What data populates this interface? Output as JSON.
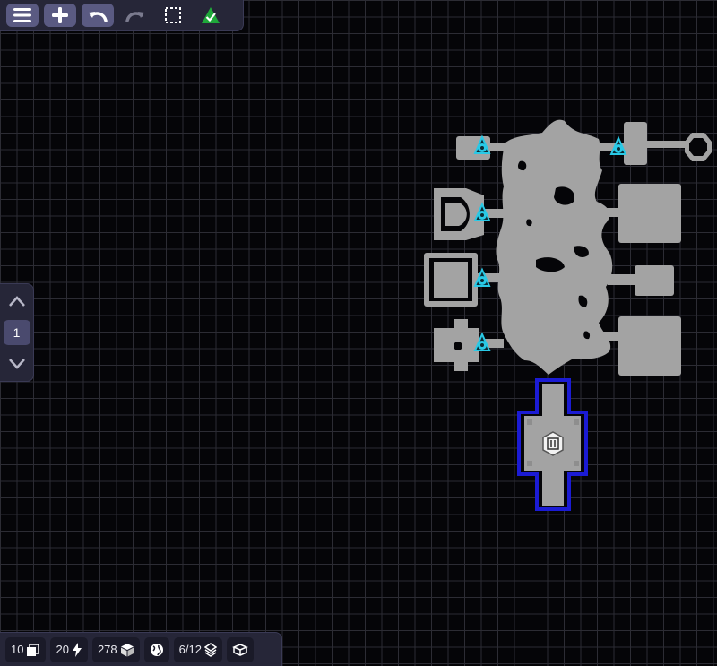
{
  "toolbar": {
    "items": [
      "menu-icon",
      "add-icon",
      "undo-icon",
      "redo-icon",
      "select-icon",
      "validate-icon"
    ]
  },
  "floor": {
    "current": "1"
  },
  "stats": {
    "tiles": "10",
    "power": "20",
    "blocks": "278",
    "rooms": "6/12"
  },
  "colors": {
    "background": "#050508",
    "grid": "#2c2c34",
    "panel": "#262638",
    "room": "#a3a3a3",
    "marker": "#29c9e6",
    "selection": "#1b1bd4",
    "validate": "#1fa83a"
  },
  "map": {
    "rooms": [
      "cave-main",
      "room-top-left",
      "room-top-right-corridor",
      "room-left-u",
      "room-right-upper",
      "room-left-frame",
      "room-right-middle",
      "room-left-cross",
      "room-right-lower",
      "selected-start-room"
    ],
    "markers": [
      "marker-1",
      "marker-2",
      "marker-3",
      "marker-4",
      "marker-5"
    ],
    "selected_room_icon": "emblem-icon"
  }
}
